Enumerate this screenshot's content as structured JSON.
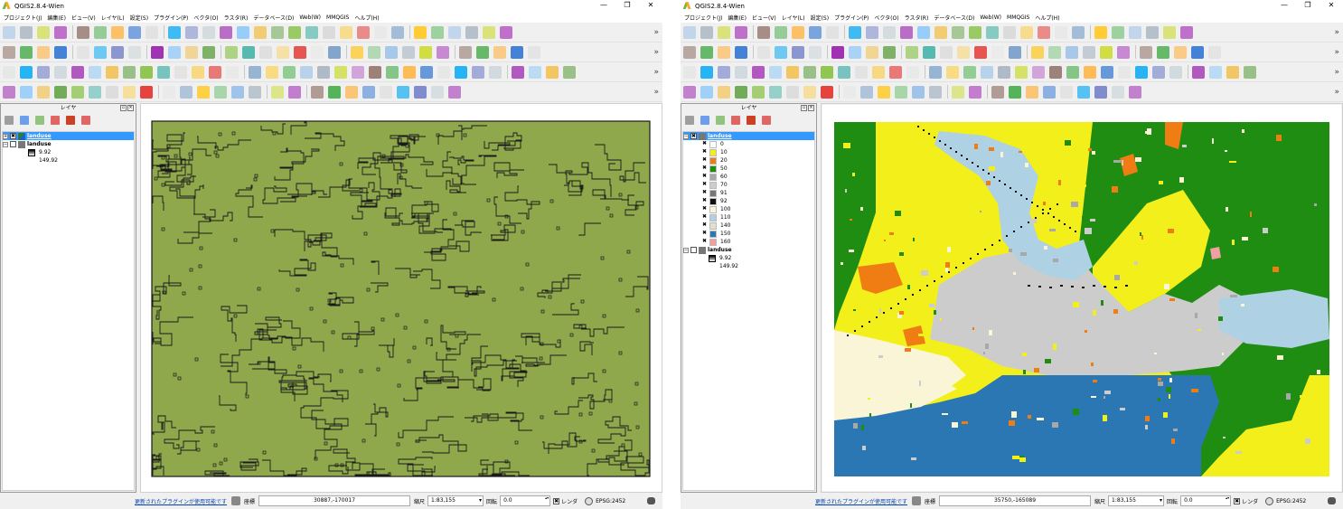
{
  "windows": [
    {
      "title": "QGIS2.8.4-Wien",
      "win_controls": [
        "—",
        "❐",
        "✕"
      ],
      "menus": [
        "プロジェクト(J)",
        "編集(E)",
        "ビュー(V)",
        "レイヤ(L)",
        "設定(S)",
        "プラグイン(P)",
        "ベクタ(O)",
        "ラスタ(R)",
        "データベース(D)",
        "Web(W)",
        "MMQGIS",
        "ヘルプ(H)"
      ],
      "panel_title": "レイヤ",
      "layers": [
        {
          "name": "landuse",
          "expanded": false,
          "checked": true,
          "selected": true
        },
        {
          "name": "landuse",
          "expanded": true,
          "checked": false,
          "selected": false,
          "legend": [
            {
              "label": "9.92",
              "color": "#000000"
            },
            {
              "label": "149.92",
              "color": "#ffffff"
            }
          ]
        }
      ],
      "status": {
        "plugin_msg": "更新されたプラグインが使用可能です",
        "coord_label": "座標",
        "coord": "30887,-170017",
        "scale_label": "縮尺",
        "scale": "1:83,155",
        "rotation_label": "回転",
        "rotation": "0.0",
        "render_label": "レンダ",
        "crs": "EPSG:2452"
      },
      "map_style": "outline"
    },
    {
      "title": "QGIS2.8.4-Wien",
      "win_controls": [
        "—",
        "❐",
        "✕"
      ],
      "menus": [
        "プロジェクト(J)",
        "編集(E)",
        "ビュー(V)",
        "レイヤ(L)",
        "設定(S)",
        "プラグイン(P)",
        "ベクタ(O)",
        "ラスタ(R)",
        "データベース(D)",
        "Web(W)",
        "MMQGIS",
        "ヘルプ(H)"
      ],
      "panel_title": "レイヤ",
      "layers": [
        {
          "name": "landuse",
          "expanded": true,
          "checked": true,
          "selected": true,
          "legend": [
            {
              "label": "0",
              "color": "#ffffff"
            },
            {
              "label": "10",
              "color": "#f2ef1a"
            },
            {
              "label": "20",
              "color": "#f07c14"
            },
            {
              "label": "50",
              "color": "#1f8c12"
            },
            {
              "label": "60",
              "color": "#a8a8a8"
            },
            {
              "label": "70",
              "color": "#cccccc"
            },
            {
              "label": "91",
              "color": "#777777"
            },
            {
              "label": "92",
              "color": "#111111"
            },
            {
              "label": "100",
              "color": "#fbf5d8"
            },
            {
              "label": "110",
              "color": "#aed1e3"
            },
            {
              "label": "140",
              "color": "#e1e1c8"
            },
            {
              "label": "150",
              "color": "#2a77b3"
            },
            {
              "label": "160",
              "color": "#f0a0a0"
            }
          ]
        },
        {
          "name": "landuse",
          "expanded": true,
          "checked": false,
          "selected": false,
          "legend": [
            {
              "label": "9.92",
              "color": "#000000"
            },
            {
              "label": "149.92",
              "color": "#ffffff"
            }
          ]
        }
      ],
      "status": {
        "plugin_msg": "更新されたプラグインが使用可能です",
        "coord_label": "座標",
        "coord": "35750,-165089",
        "scale_label": "縮尺",
        "scale": "1:83,155",
        "rotation_label": "回転",
        "rotation": "0.0",
        "render_label": "レンダ",
        "crs": "EPSG:2452"
      },
      "map_style": "classified"
    }
  ],
  "colors": {
    "outline_fill": "#8fa84c",
    "outline_stroke": "#1a1a1a",
    "yellow": "#f2ef1a",
    "orange": "#f07c14",
    "green": "#1f8c12",
    "lightgrey": "#cccccc",
    "grey": "#a8a8a8",
    "black": "#111111",
    "beige": "#fbf5d8",
    "water": "#aed1e3",
    "sea": "#2a77b3",
    "pink": "#f0a0a0",
    "white": "#ffffff"
  }
}
